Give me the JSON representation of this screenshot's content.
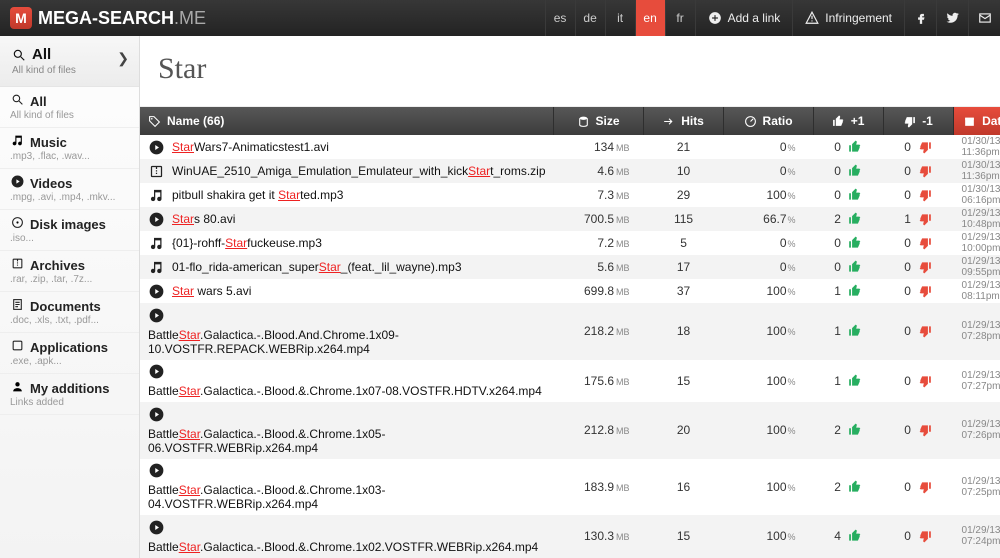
{
  "logo": {
    "badge": "M",
    "textA": "MEGA-SEARCH",
    "textB": ".ME"
  },
  "langs": [
    "es",
    "de",
    "it",
    "en",
    "fr"
  ],
  "activeLang": "en",
  "topBtns": {
    "add": "Add a link",
    "infr": "Infringement"
  },
  "sidebar": {
    "head": {
      "title": "All",
      "sub": "All kind of files"
    },
    "items": [
      {
        "icon": "search",
        "title": "All",
        "sub": "All kind of files"
      },
      {
        "icon": "music",
        "title": "Music",
        "sub": ".mp3, .flac, .wav..."
      },
      {
        "icon": "video",
        "title": "Videos",
        "sub": ".mpg, .avi, .mp4, .mkv..."
      },
      {
        "icon": "disk",
        "title": "Disk images",
        "sub": ".iso..."
      },
      {
        "icon": "archive",
        "title": "Archives",
        "sub": ".rar, .zip, .tar, .7z..."
      },
      {
        "icon": "doc",
        "title": "Documents",
        "sub": ".doc, .xls, .txt, .pdf..."
      },
      {
        "icon": "app",
        "title": "Applications",
        "sub": ".exe, .apk..."
      },
      {
        "icon": "user",
        "title": "My additions",
        "sub": "Links added"
      }
    ]
  },
  "searchTerm": "Star",
  "columns": {
    "name": "Name (66)",
    "size": "Size",
    "hits": "Hits",
    "ratio": "Ratio",
    "plus": "+1",
    "minus": "-1",
    "date": "Date"
  },
  "rows": [
    {
      "type": "video",
      "nameParts": [
        [
          "hl",
          "Star"
        ],
        [
          "",
          "Wars7-Animaticstest1.avi"
        ]
      ],
      "size": "134",
      "unit": "MB",
      "hits": "21",
      "ratio": "0",
      "plus": "0",
      "minus": "0",
      "date1": "01/30/13",
      "date2": "11:36pm"
    },
    {
      "type": "archive",
      "nameParts": [
        [
          "",
          "WinUAE_2510_Amiga_Emulation_Emulateur_with_kick"
        ],
        [
          "hl",
          "Star"
        ],
        [
          "",
          "t_roms.zip"
        ]
      ],
      "size": "4.6",
      "unit": "MB",
      "hits": "10",
      "ratio": "0",
      "plus": "0",
      "minus": "0",
      "date1": "01/30/13",
      "date2": "11:36pm"
    },
    {
      "type": "music",
      "nameParts": [
        [
          "",
          "pitbull shakira get it "
        ],
        [
          "hl",
          "Star"
        ],
        [
          "",
          "ted.mp3"
        ]
      ],
      "size": "7.3",
      "unit": "MB",
      "hits": "29",
      "ratio": "100",
      "plus": "0",
      "minus": "0",
      "date1": "01/30/13",
      "date2": "06:16pm"
    },
    {
      "type": "video",
      "nameParts": [
        [
          "hl",
          "Star"
        ],
        [
          "",
          "s 80.avi"
        ]
      ],
      "size": "700.5",
      "unit": "MB",
      "hits": "115",
      "ratio": "66.7",
      "plus": "2",
      "minus": "1",
      "date1": "01/29/13",
      "date2": "10:48pm"
    },
    {
      "type": "music",
      "nameParts": [
        [
          "",
          "{01}-rohff-"
        ],
        [
          "hl",
          "Star"
        ],
        [
          "",
          "fuckeuse.mp3"
        ]
      ],
      "size": "7.2",
      "unit": "MB",
      "hits": "5",
      "ratio": "0",
      "plus": "0",
      "minus": "0",
      "date1": "01/29/13",
      "date2": "10:00pm"
    },
    {
      "type": "music",
      "nameParts": [
        [
          "",
          "01-flo_rida-american_super"
        ],
        [
          "hl",
          "Star"
        ],
        [
          "",
          "_(feat._lil_wayne).mp3"
        ]
      ],
      "size": "5.6",
      "unit": "MB",
      "hits": "17",
      "ratio": "0",
      "plus": "0",
      "minus": "0",
      "date1": "01/29/13",
      "date2": "09:55pm"
    },
    {
      "type": "video",
      "nameParts": [
        [
          "hl",
          "Star"
        ],
        [
          "",
          " wars 5.avi"
        ]
      ],
      "size": "699.8",
      "unit": "MB",
      "hits": "37",
      "ratio": "100",
      "plus": "1",
      "minus": "0",
      "date1": "01/29/13",
      "date2": "08:11pm"
    },
    {
      "type": "video",
      "tall": true,
      "nameParts": [
        [
          "",
          "Battle"
        ],
        [
          "hl",
          "Star"
        ],
        [
          "",
          ".Galactica.-.Blood.And.Chrome.1x09-10.VOSTFR.REPACK.WEBRip.x264.mp4"
        ]
      ],
      "size": "218.2",
      "unit": "MB",
      "hits": "18",
      "ratio": "100",
      "plus": "1",
      "minus": "0",
      "date1": "01/29/13",
      "date2": "07:28pm"
    },
    {
      "type": "video",
      "tall": true,
      "nameParts": [
        [
          "",
          "Battle"
        ],
        [
          "hl",
          "Star"
        ],
        [
          "",
          ".Galactica.-.Blood.&.Chrome.1x07-08.VOSTFR.HDTV.x264.mp4"
        ]
      ],
      "size": "175.6",
      "unit": "MB",
      "hits": "15",
      "ratio": "100",
      "plus": "1",
      "minus": "0",
      "date1": "01/29/13",
      "date2": "07:27pm"
    },
    {
      "type": "video",
      "tall": true,
      "nameParts": [
        [
          "",
          "Battle"
        ],
        [
          "hl",
          "Star"
        ],
        [
          "",
          ".Galactica.-.Blood.&.Chrome.1x05-06.VOSTFR.WEBRip.x264.mp4"
        ]
      ],
      "size": "212.8",
      "unit": "MB",
      "hits": "20",
      "ratio": "100",
      "plus": "2",
      "minus": "0",
      "date1": "01/29/13",
      "date2": "07:26pm"
    },
    {
      "type": "video",
      "tall": true,
      "nameParts": [
        [
          "",
          "Battle"
        ],
        [
          "hl",
          "Star"
        ],
        [
          "",
          ".Galactica.-.Blood.&.Chrome.1x03-04.VOSTFR.WEBRip.x264.mp4"
        ]
      ],
      "size": "183.9",
      "unit": "MB",
      "hits": "16",
      "ratio": "100",
      "plus": "2",
      "minus": "0",
      "date1": "01/29/13",
      "date2": "07:25pm"
    },
    {
      "type": "video",
      "tall": true,
      "nameParts": [
        [
          "",
          "Battle"
        ],
        [
          "hl",
          "Star"
        ],
        [
          "",
          ".Galactica.-.Blood.&.Chrome.1x02.VOSTFR.WEBRip.x264.mp4"
        ]
      ],
      "size": "130.3",
      "unit": "MB",
      "hits": "15",
      "ratio": "100",
      "plus": "4",
      "minus": "0",
      "date1": "01/29/13",
      "date2": "07:24pm"
    }
  ]
}
